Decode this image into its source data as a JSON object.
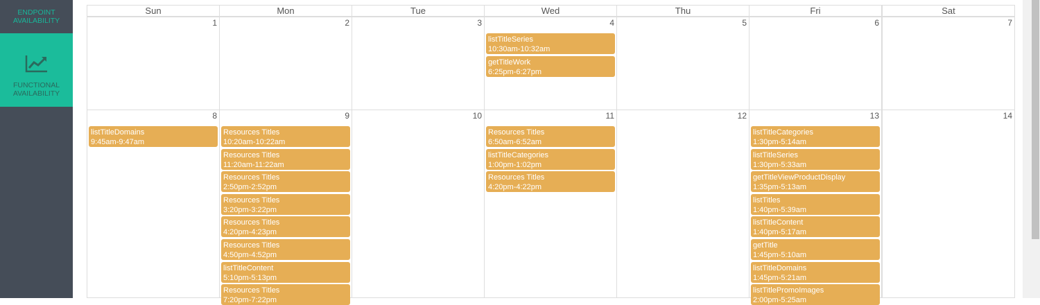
{
  "sidebar": {
    "items": [
      {
        "label": "ENDPOINT AVAILABILITY",
        "active": false
      },
      {
        "label": "FUNCTIONAL AVAILABILITY",
        "active": true,
        "icon": "line-chart-icon"
      }
    ]
  },
  "calendar": {
    "day_headers": [
      "Sun",
      "Mon",
      "Tue",
      "Wed",
      "Thu",
      "Fri",
      "Sat"
    ],
    "weeks": [
      {
        "days": [
          {
            "num": "1",
            "events": []
          },
          {
            "num": "2",
            "events": []
          },
          {
            "num": "3",
            "events": []
          },
          {
            "num": "4",
            "events": [
              {
                "title": "listTitleSeries",
                "time": "10:30am-10:32am"
              },
              {
                "title": "getTitleWork",
                "time": "6:25pm-6:27pm"
              }
            ]
          },
          {
            "num": "5",
            "events": []
          },
          {
            "num": "6",
            "events": []
          },
          {
            "num": "7",
            "events": []
          }
        ]
      },
      {
        "days": [
          {
            "num": "8",
            "events": [
              {
                "title": "listTitleDomains",
                "time": "9:45am-9:47am"
              }
            ]
          },
          {
            "num": "9",
            "events": [
              {
                "title": "Resources Titles",
                "time": "10:20am-10:22am"
              },
              {
                "title": "Resources Titles",
                "time": "11:20am-11:22am"
              },
              {
                "title": "Resources Titles",
                "time": "2:50pm-2:52pm"
              },
              {
                "title": "Resources Titles",
                "time": "3:20pm-3:22pm"
              },
              {
                "title": "Resources Titles",
                "time": "4:20pm-4:23pm"
              },
              {
                "title": "Resources Titles",
                "time": "4:50pm-4:52pm"
              },
              {
                "title": "listTitleContent",
                "time": "5:10pm-5:13pm"
              },
              {
                "title": "Resources Titles",
                "time": "7:20pm-7:22pm"
              }
            ]
          },
          {
            "num": "10",
            "events": []
          },
          {
            "num": "11",
            "events": [
              {
                "title": "Resources Titles",
                "time": "6:50am-6:52am"
              },
              {
                "title": "listTitleCategories",
                "time": "1:00pm-1:02pm"
              },
              {
                "title": "Resources Titles",
                "time": "4:20pm-4:22pm"
              }
            ]
          },
          {
            "num": "12",
            "events": []
          },
          {
            "num": "13",
            "events": [
              {
                "title": "listTitleCategories",
                "time": "1:30pm-5:14am"
              },
              {
                "title": "listTitleSeries",
                "time": "1:30pm-5:33am"
              },
              {
                "title": "getTitleViewProductDisplay",
                "time": "1:35pm-5:13am"
              },
              {
                "title": "listTitles",
                "time": "1:40pm-5:39am"
              },
              {
                "title": "listTitleContent",
                "time": "1:40pm-5:17am"
              },
              {
                "title": "getTitle",
                "time": "1:45pm-5:10am"
              },
              {
                "title": "listTitleDomains",
                "time": "1:45pm-5:21am"
              },
              {
                "title": "listTitlePromoImages",
                "time": "2:00pm-5:25am"
              }
            ]
          },
          {
            "num": "14",
            "events": []
          }
        ]
      }
    ]
  },
  "colors": {
    "sidebar_bg": "#454d58",
    "sidebar_active_bg": "#1bbc9b",
    "event_bg": "#e6ae55",
    "grid_border": "#dddddd"
  }
}
